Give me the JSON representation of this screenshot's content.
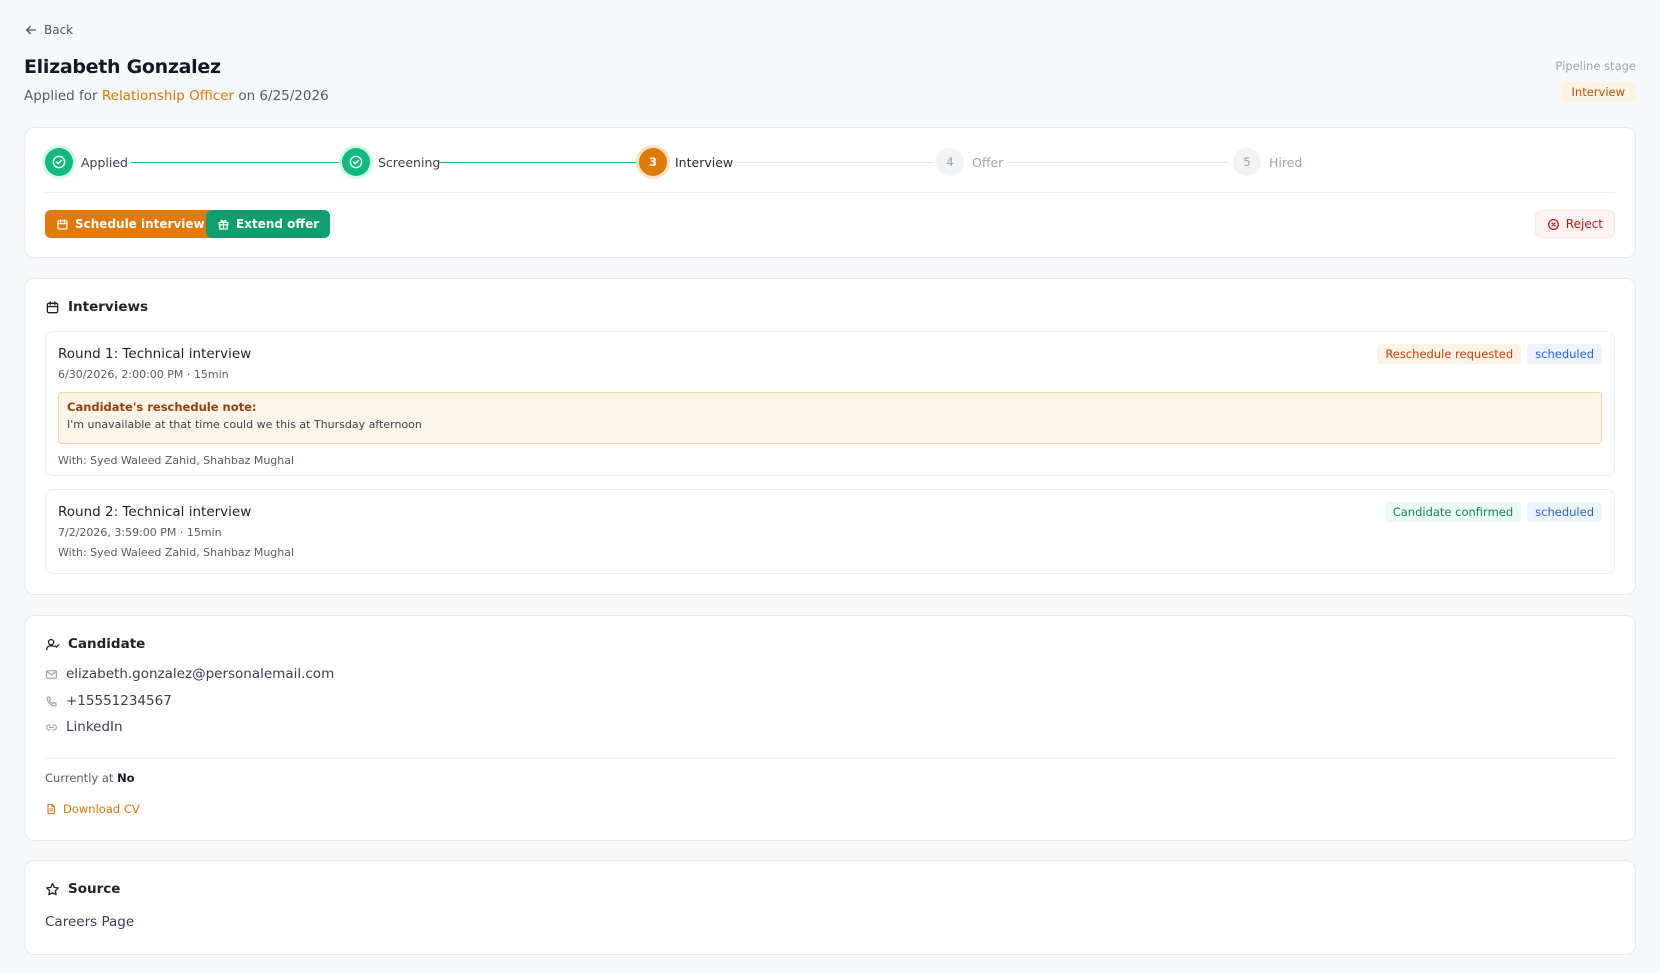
{
  "header": {
    "back_label": "Back",
    "candidate_name": "Elizabeth Gonzalez",
    "applied_prefix": "Applied for",
    "role": "Relationship Officer",
    "applied_on": "on 6/25/2026",
    "pipeline_stage_label": "Pipeline stage",
    "pipeline_stage_value": "Interview"
  },
  "pipeline": {
    "steps": [
      {
        "label": "Applied",
        "number": "1",
        "state": "done"
      },
      {
        "label": "Screening",
        "number": "2",
        "state": "done"
      },
      {
        "label": "Interview",
        "number": "3",
        "state": "current"
      },
      {
        "label": "Offer",
        "number": "4",
        "state": "todo"
      },
      {
        "label": "Hired",
        "number": "5",
        "state": "todo"
      }
    ],
    "actions": {
      "schedule": "Schedule interview",
      "offer": "Extend offer",
      "reject": "Reject"
    }
  },
  "interviews": {
    "heading": "Interviews",
    "items": [
      {
        "title": "Round 1: Technical interview",
        "datetime": "6/30/2026, 2:00:00 PM · 15min",
        "status_badge": "Reschedule requested",
        "state_badge": "scheduled",
        "note_title": "Candidate's reschedule note:",
        "note_text": "I'm unavailable at that time could we this at Thursday afternoon",
        "with": "With: Syed Waleed Zahid, Shahbaz Mughal"
      },
      {
        "title": "Round 2: Technical interview",
        "datetime": "7/2/2026, 3:59:00 PM · 15min",
        "status_badge": "Candidate confirmed",
        "state_badge": "scheduled",
        "with": "With: Syed Waleed Zahid, Shahbaz Mughal"
      }
    ]
  },
  "candidate": {
    "heading": "Candidate",
    "email": "elizabeth.gonzalez@personalemail.com",
    "phone": "+15551234567",
    "linkedin": "LinkedIn",
    "currently_at_label": "Currently at",
    "currently_at_value": "No",
    "download_cv": "Download CV"
  },
  "source": {
    "heading": "Source",
    "value": "Careers Page"
  },
  "colors": {
    "accent_orange": "#e07a0b",
    "accent_green": "#0f9f6e",
    "reject_red": "#b91c1c"
  }
}
